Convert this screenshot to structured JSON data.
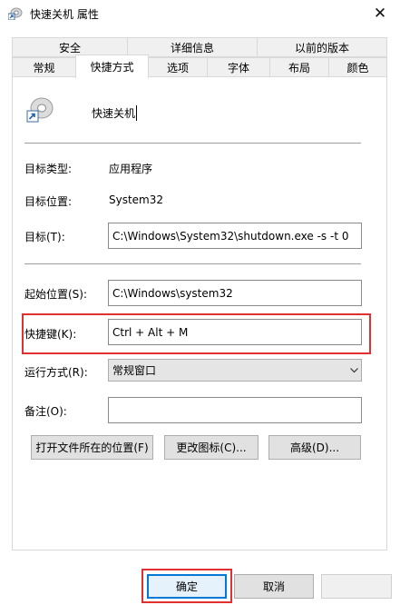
{
  "window": {
    "title": "快速关机 属性",
    "close_glyph": "✕"
  },
  "tabs_row1": [
    "安全",
    "详细信息",
    "以前的版本"
  ],
  "tabs_row2": [
    "常规",
    "快捷方式",
    "选项",
    "字体",
    "布局",
    "颜色"
  ],
  "active_tab": "快捷方式",
  "shortcut": {
    "name": "快速关机",
    "target_type_label": "目标类型:",
    "target_type_value": "应用程序",
    "target_location_label": "目标位置:",
    "target_location_value": "System32",
    "target_label": "目标(T):",
    "target_value": "C:\\Windows\\System32\\shutdown.exe -s -t 0",
    "start_in_label": "起始位置(S):",
    "start_in_value": "C:\\Windows\\system32",
    "hotkey_label": "快捷键(K):",
    "hotkey_value": "Ctrl + Alt + M",
    "run_label": "运行方式(R):",
    "run_value": "常规窗口",
    "comment_label": "备注(O):",
    "comment_value": ""
  },
  "buttons": {
    "open_location": "打开文件所在的位置(F)",
    "change_icon": "更改图标(C)...",
    "advanced": "高级(D)...",
    "ok": "确定",
    "cancel": "取消"
  },
  "colors": {
    "highlight": "#e03030",
    "focus": "#0078d7"
  }
}
